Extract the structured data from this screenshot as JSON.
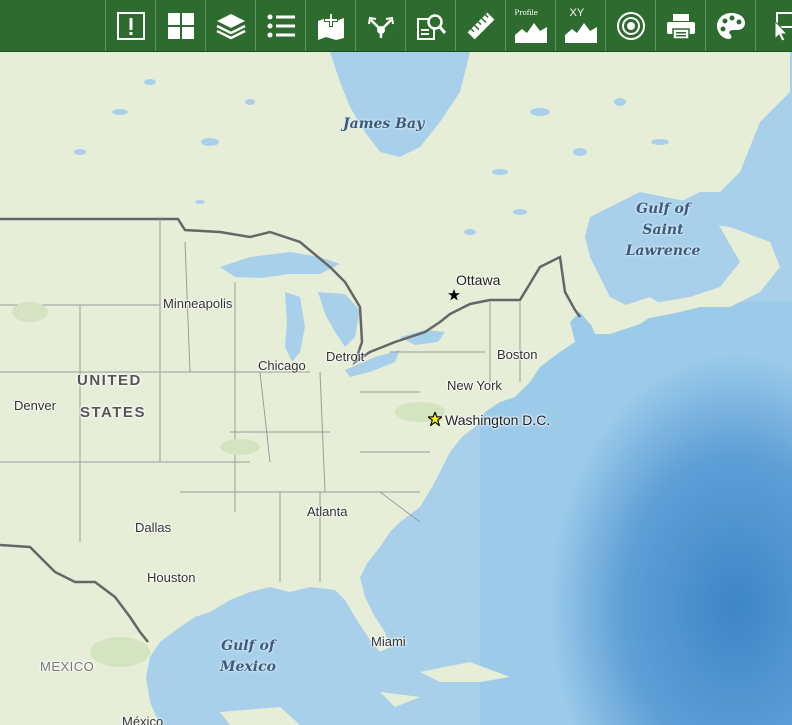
{
  "toolbar": {
    "tools": [
      {
        "icon": "alert-icon"
      },
      {
        "icon": "basemap-gallery-icon"
      },
      {
        "icon": "layers-icon"
      },
      {
        "icon": "legend-icon"
      },
      {
        "icon": "add-data-icon"
      },
      {
        "icon": "share-icon"
      },
      {
        "icon": "query-icon"
      },
      {
        "icon": "measure-icon"
      },
      {
        "icon": "elevation-profile-icon",
        "label": "Profile"
      },
      {
        "icon": "coordinates-icon",
        "label": "XY"
      },
      {
        "icon": "buffer-icon"
      },
      {
        "icon": "print-icon"
      },
      {
        "icon": "styles-palette-icon"
      },
      {
        "icon": "select-icon"
      }
    ]
  },
  "map": {
    "water_labels": {
      "james_bay": "James Bay",
      "gulf_st_lawrence": [
        "Gulf of",
        "Saint",
        "Lawrence"
      ],
      "gulf_mexico": [
        "Gulf of",
        "Mexico"
      ]
    },
    "country_labels": {
      "usa": [
        "UNITED",
        "STATES"
      ],
      "mexico": "MEXICO"
    },
    "cities": {
      "ottawa": "Ottawa",
      "washington": "Washington D.C.",
      "minneapolis": "Minneapolis",
      "detroit": "Detroit",
      "chicago": "Chicago",
      "boston": "Boston",
      "new_york": "New York",
      "denver": "Denver",
      "atlanta": "Atlanta",
      "dallas": "Dallas",
      "houston": "Houston",
      "miami": "Miami",
      "mexico_city": "México"
    },
    "colors": {
      "toolbar": "#2e6b2e",
      "land": "#e9efd9",
      "water": "#a8cfe8",
      "deep_water": "#5b9dd4",
      "border": "#666666",
      "capital_star": "#ffff00"
    }
  }
}
